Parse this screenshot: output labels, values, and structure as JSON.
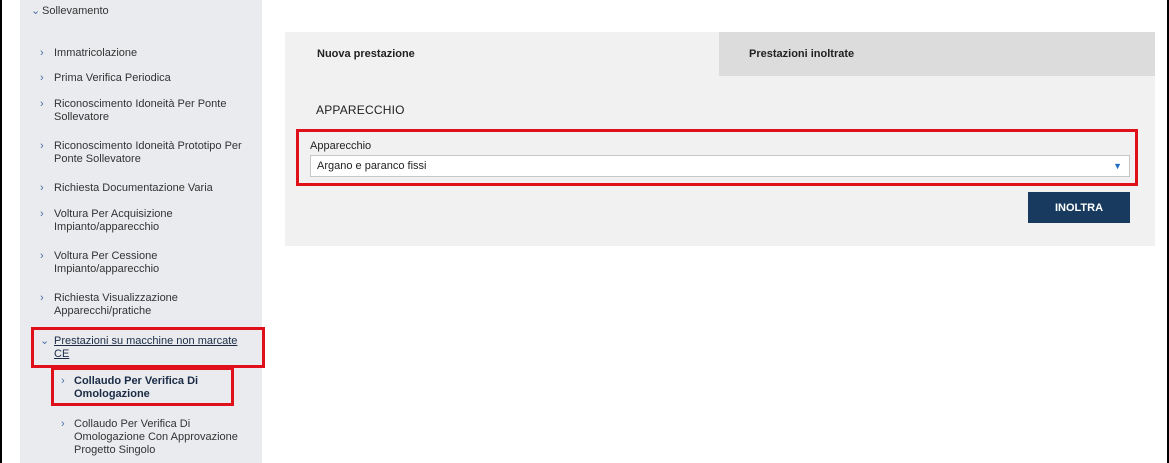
{
  "sidebar": {
    "items": [
      {
        "label": "Sollevamento",
        "icon": "chevron-down-icon"
      },
      {
        "label": "Immatricolazione",
        "icon": "chevron-right-icon"
      },
      {
        "label": "Prima Verifica Periodica",
        "icon": "chevron-right-icon"
      },
      {
        "label": "Riconoscimento Idoneità Per Ponte",
        "label2": "Sollevatore",
        "icon": "chevron-right-icon"
      },
      {
        "label": "Riconoscimento Idoneità Prototipo Per",
        "label2": "Ponte Sollevatore",
        "icon": "chevron-right-icon"
      },
      {
        "label": "Richiesta Documentazione Varia",
        "icon": "chevron-right-icon"
      },
      {
        "label": "Voltura Per Acquisizione",
        "label2": "Impianto/apparecchio",
        "icon": "chevron-right-icon"
      },
      {
        "label": "Voltura Per Cessione",
        "label2": "Impianto/apparecchio",
        "icon": "chevron-right-icon"
      },
      {
        "label": "Richiesta Visualizzazione",
        "label2": "Apparecchi/pratiche",
        "icon": "chevron-right-icon"
      },
      {
        "label": "Prestazioni su macchine non marcate",
        "label2": "CE",
        "icon": "chevron-down-icon"
      },
      {
        "label": "Collaudo Per Verifica Di",
        "label2": "Omologazione",
        "icon": "chevron-right-icon"
      },
      {
        "label": "Collaudo Per Verifica Di",
        "label2": "Omologazione Con Approvazione",
        "label3": "Progetto Singolo",
        "icon": "chevron-right-icon"
      }
    ]
  },
  "tabs": {
    "new_label": "Nuova prestazione",
    "sent_label": "Prestazioni inoltrate"
  },
  "form": {
    "section_title": "APPARECCHIO",
    "field_label": "Apparecchio",
    "field_value": "Argano e paranco fissi",
    "submit_label": "INOLTRA"
  },
  "colors": {
    "highlight": "#e0101a",
    "button": "#173a5e",
    "sidebar_bg": "#e9ebee"
  }
}
